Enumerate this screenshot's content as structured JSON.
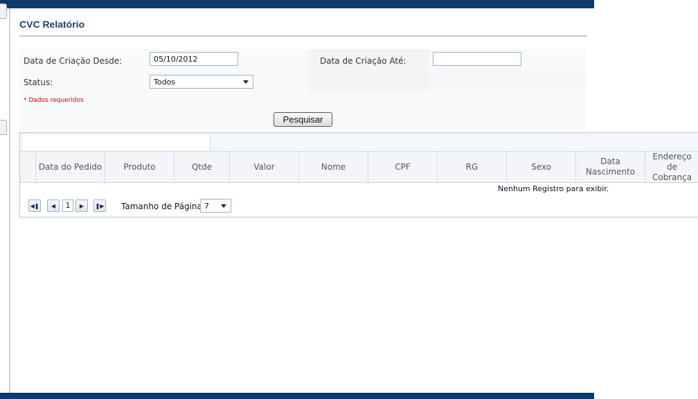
{
  "header": {
    "title": "CVC Relatório"
  },
  "form": {
    "date_from_label": "Data de Criação Desde:",
    "date_from_value": "05/10/2012",
    "date_to_label": "Data de Criação Até:",
    "date_to_value": "",
    "status_label": "Status:",
    "status_value": "Todos",
    "required_note": "* Dados requeridos",
    "search_label": "Pesquisar"
  },
  "grid": {
    "columns": [
      "Data do Pedido",
      "Produto",
      "Qtde",
      "Valor",
      "Nome",
      "CPF",
      "RG",
      "Sexo",
      "Data Nascimento",
      "Endereço de Cobrança"
    ],
    "empty_message": "Nenhum Registro para exibir.",
    "pager": {
      "current_page": "1",
      "page_size_label": "Tamanho de Página:",
      "page_size_value": "7"
    }
  },
  "colors": {
    "nav": "#0d3a6b",
    "title": "#1c3f73",
    "required": "#cc0000"
  }
}
